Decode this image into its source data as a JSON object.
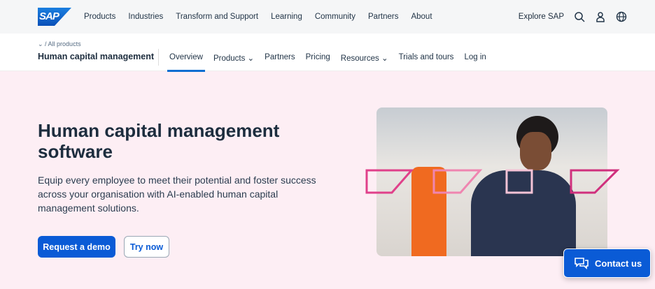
{
  "header": {
    "logo": "SAP",
    "nav": [
      "Products",
      "Industries",
      "Transform and Support",
      "Learning",
      "Community",
      "Partners",
      "About"
    ],
    "explore": "Explore SAP"
  },
  "subheader": {
    "breadcrumb": "⌄ / All products",
    "title": "Human capital management",
    "nav": [
      "Overview",
      "Products",
      "Partners",
      "Pricing",
      "Resources",
      "Trials and tours",
      "Log in"
    ]
  },
  "hero": {
    "title": "Human capital management software",
    "description": "Equip every employee to meet their potential and foster success across your organisation with AI-enabled human capital management solutions.",
    "primary_button": "Request a demo",
    "secondary_button": "Try now"
  },
  "contact": {
    "label": "Contact us"
  },
  "colors": {
    "accent": "#0a5bd6",
    "hero_bg": "#fdeef4",
    "shape": "#e0408a"
  }
}
